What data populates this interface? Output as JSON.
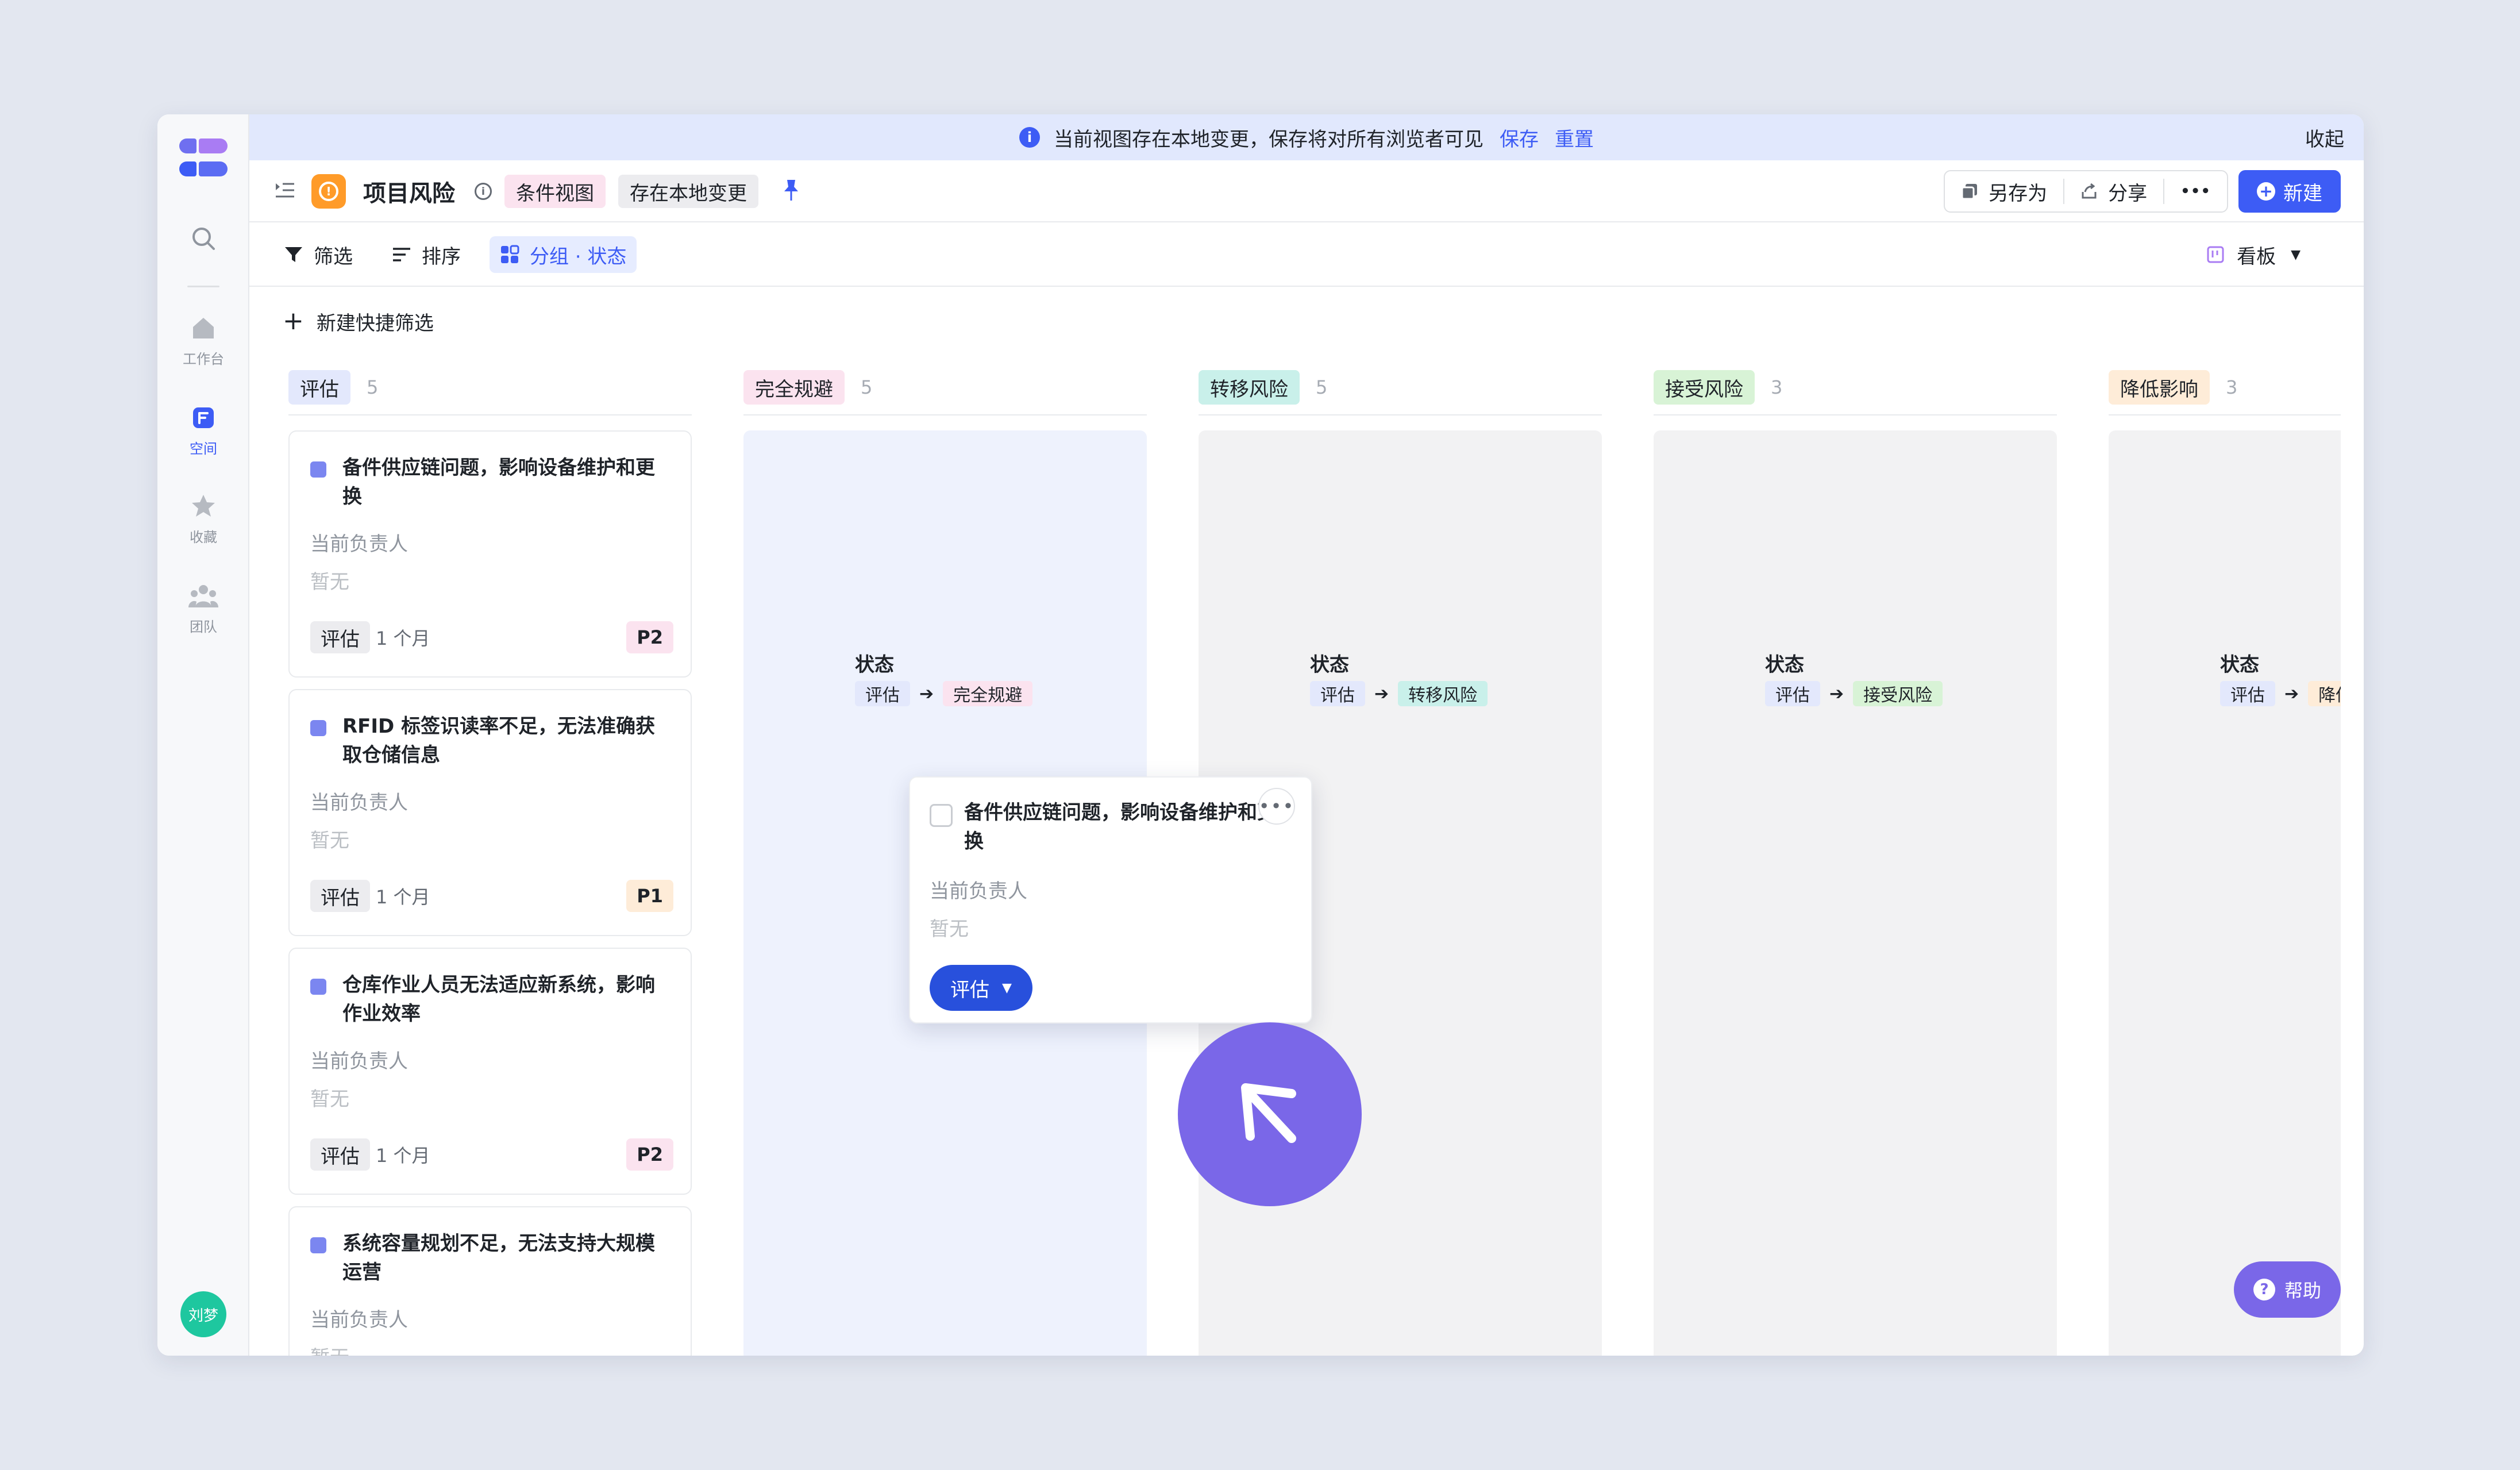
{
  "notice": {
    "message": "当前视图存在本地变更，保存将对所有浏览者可见",
    "save": "保存",
    "reset": "重置",
    "collapse": "收起"
  },
  "rail": {
    "items": [
      {
        "label": "工作台",
        "icon": "home-icon"
      },
      {
        "label": "空间",
        "icon": "space-icon",
        "active": true
      },
      {
        "label": "收藏",
        "icon": "star-icon"
      },
      {
        "label": "团队",
        "icon": "team-icon"
      }
    ],
    "avatar": "刘梦"
  },
  "titlebar": {
    "title": "项目风险",
    "chip_view": "条件视图",
    "chip_local": "存在本地变更",
    "save_as": "另存为",
    "share": "分享",
    "more": "•••",
    "new": "新建"
  },
  "toolbar": {
    "filter": "筛选",
    "sort": "排序",
    "group": "分组 · 状态",
    "view": "看板"
  },
  "quickfilter": {
    "label": "新建快捷筛选"
  },
  "columns": [
    {
      "name": "评估",
      "count": "5",
      "color": "#e3e8fc"
    },
    {
      "name": "完全规避",
      "count": "5",
      "color": "#fbe3ef"
    },
    {
      "name": "转移风险",
      "count": "5",
      "color": "#c9f0ea"
    },
    {
      "name": "接受风险",
      "count": "3",
      "color": "#d8f3d6"
    },
    {
      "name": "降低影响",
      "count": "3",
      "color": "#feecd8"
    }
  ],
  "ghost": {
    "label": "状态",
    "from": "评估",
    "targets": [
      "完全规避",
      "转移风险",
      "接受风险",
      "降低影响"
    ]
  },
  "cards": [
    {
      "title": "备件供应链问题，影响设备维护和更换",
      "owner_label": "当前负责人",
      "owner": "暂无",
      "status": "评估",
      "due": "1 个月",
      "priority": "P2"
    },
    {
      "title": "RFID 标签识读率不足，无法准确获取仓储信息",
      "owner_label": "当前负责人",
      "owner": "暂无",
      "status": "评估",
      "due": "1 个月",
      "priority": "P1"
    },
    {
      "title": "仓库作业人员无法适应新系统，影响作业效率",
      "owner_label": "当前负责人",
      "owner": "暂无",
      "status": "评估",
      "due": "1 个月",
      "priority": "P2"
    },
    {
      "title": "系统容量规划不足，无法支持大规模运营",
      "owner_label": "当前负责人",
      "owner": "暂无",
      "status": "",
      "due": "",
      "priority": ""
    }
  ],
  "drag_card": {
    "title": "备件供应链问题，影响设备维护和更换",
    "owner_label": "当前负责人",
    "owner": "暂无",
    "status": "评估"
  },
  "help": {
    "label": "帮助"
  }
}
